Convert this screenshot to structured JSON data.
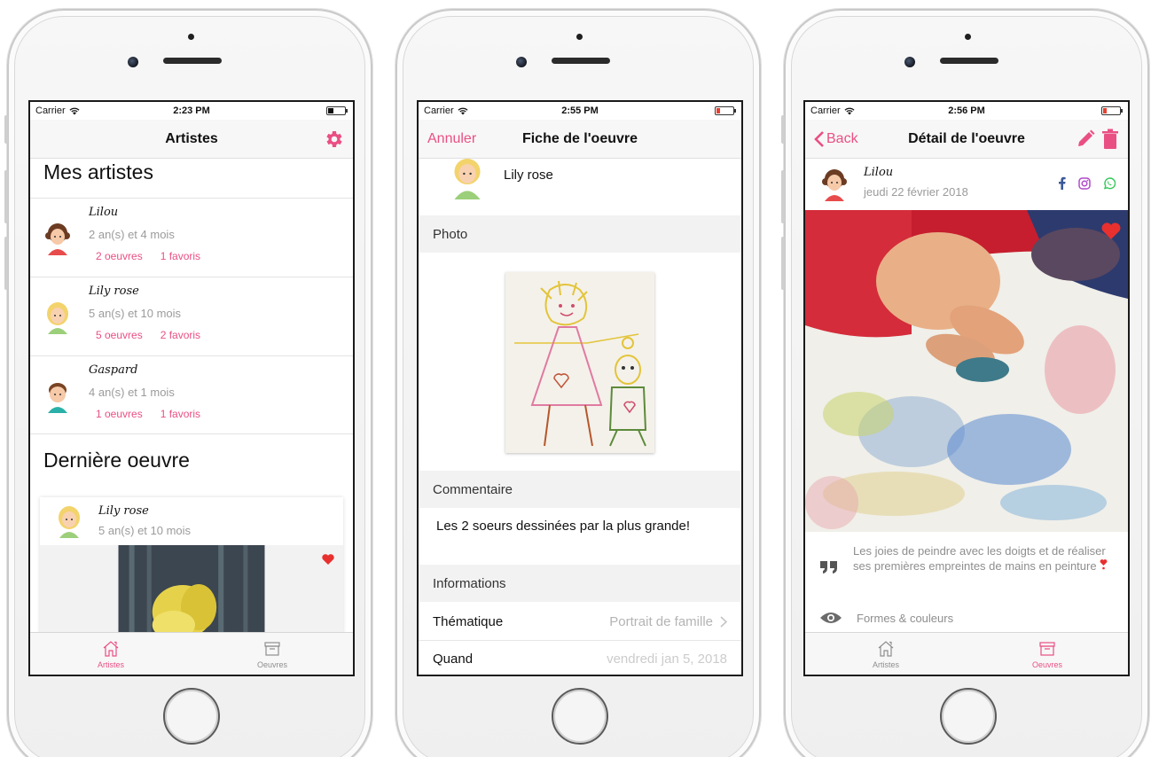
{
  "screen1": {
    "status": {
      "carrier": "Carrier",
      "time": "2:23 PM"
    },
    "nav_title": "Artistes",
    "section_artists": "Mes artistes",
    "artists": [
      {
        "name": "Lilou",
        "age": "2 an(s) et 4 mois",
        "works": "2 oeuvres",
        "favs": "1 favoris"
      },
      {
        "name": "Lily rose",
        "age": "5 an(s) et 10 mois",
        "works": "5 oeuvres",
        "favs": "2 favoris"
      },
      {
        "name": "Gaspard",
        "age": "4 an(s) et 1 mois",
        "works": "1 oeuvres",
        "favs": "1 favoris"
      }
    ],
    "section_last": "Dernière oeuvre",
    "last_work": {
      "name": "Lily rose",
      "age": "5 an(s) et 10 mois"
    },
    "tabs": [
      {
        "label": "Artistes",
        "icon": "home-icon"
      },
      {
        "label": "Oeuvres",
        "icon": "archive-icon"
      }
    ]
  },
  "screen2": {
    "status": {
      "carrier": "Carrier",
      "time": "2:55 PM"
    },
    "nav_left": "Annuler",
    "nav_title": "Fiche de l'oeuvre",
    "artist_name": "Lily rose",
    "photo_header": "Photo",
    "comment_header": "Commentaire",
    "comment_text": "Les 2 soeurs dessinées par la plus grande!",
    "info_header": "Informations",
    "theme_label": "Thématique",
    "theme_value": "Portrait de famille",
    "when_label": "Quand",
    "when_value": "vendredi jan 5, 2018"
  },
  "screen3": {
    "status": {
      "carrier": "Carrier",
      "time": "2:56 PM"
    },
    "nav_left": "Back",
    "nav_title": "Détail de l'oeuvre",
    "artist_name": "Lilou",
    "date": "jeudi 22 février 2018",
    "description": "Les joies de peindre avec les doigts et de réaliser ses premières empreintes de mains en peinture",
    "category": "Formes & couleurs",
    "tabs": [
      {
        "label": "Artistes",
        "icon": "home-icon"
      },
      {
        "label": "Oeuvres",
        "icon": "archive-icon"
      }
    ]
  },
  "colors": {
    "accent": "#ea4f84",
    "heart": "#e8302f"
  }
}
